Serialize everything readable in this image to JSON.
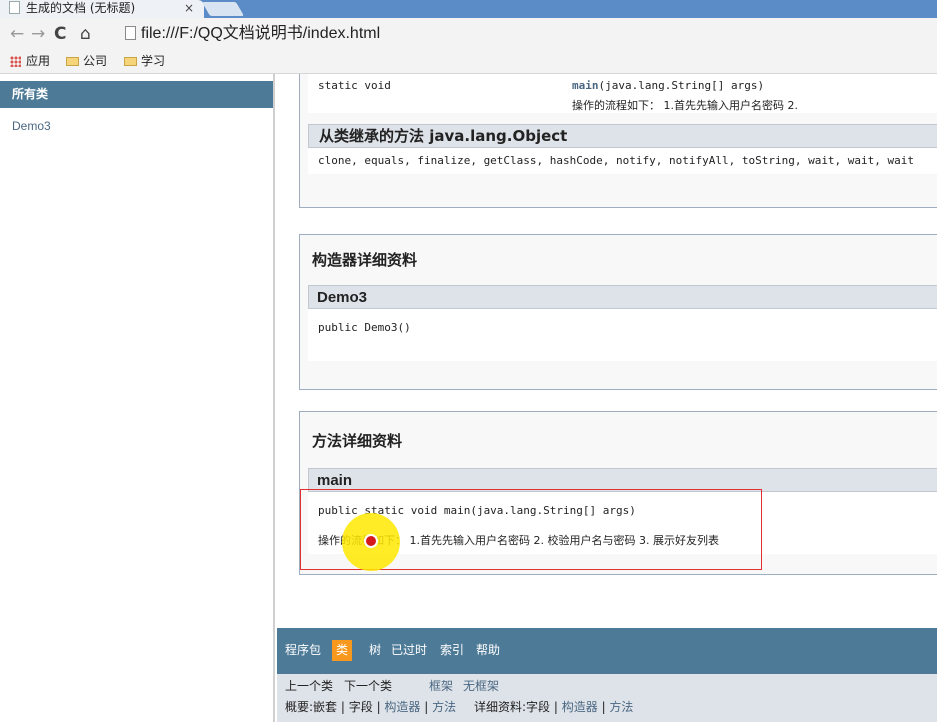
{
  "browser": {
    "tab_title": "生成的文档 (无标题)",
    "tab_close": "×",
    "url": "file:///F:/QQ文档说明书/index.html",
    "nav": {
      "back": "←",
      "forward": "→",
      "reload": "C",
      "home": "⌂"
    },
    "bookmarks": [
      "应用",
      "公司",
      "学习"
    ]
  },
  "left_frame": {
    "heading": "所有类",
    "classes": [
      "Demo3"
    ]
  },
  "method_summary": {
    "modifier": "static void",
    "method_name": "main",
    "method_params": "(java.lang.String[] args)",
    "description": "操作的流程如下： 1.首先先输入用户名密码 2."
  },
  "inherited": {
    "heading": "从类继承的方法 java.lang.Object",
    "methods": "clone, equals, finalize, getClass, hashCode, notify, notifyAll, toString, wait, wait, wait"
  },
  "constructor_detail": {
    "heading": "构造器详细资料",
    "name": "Demo3",
    "signature": "public Demo3()"
  },
  "method_detail": {
    "heading": "方法详细资料",
    "name": "main",
    "signature": "public static void main(java.lang.String[] args)",
    "description": "操作的流程如下： 1.首先先输入用户名密码 2. 校验用户名与密码 3. 展示好友列表"
  },
  "navbar": {
    "items": [
      "程序包",
      "类",
      "树",
      "已过时",
      "索引",
      "帮助"
    ],
    "active": "类"
  },
  "subnav": {
    "prev_class": "上一个类",
    "next_class": "下一个类",
    "frames": "框架",
    "no_frames": "无框架",
    "summary_label": "概要:",
    "summary_items": [
      "嵌套",
      "字段",
      "构造器",
      "方法"
    ],
    "detail_label": "详细资料:",
    "detail_items": [
      "字段",
      "构造器",
      "方法"
    ],
    "separator": " | "
  }
}
